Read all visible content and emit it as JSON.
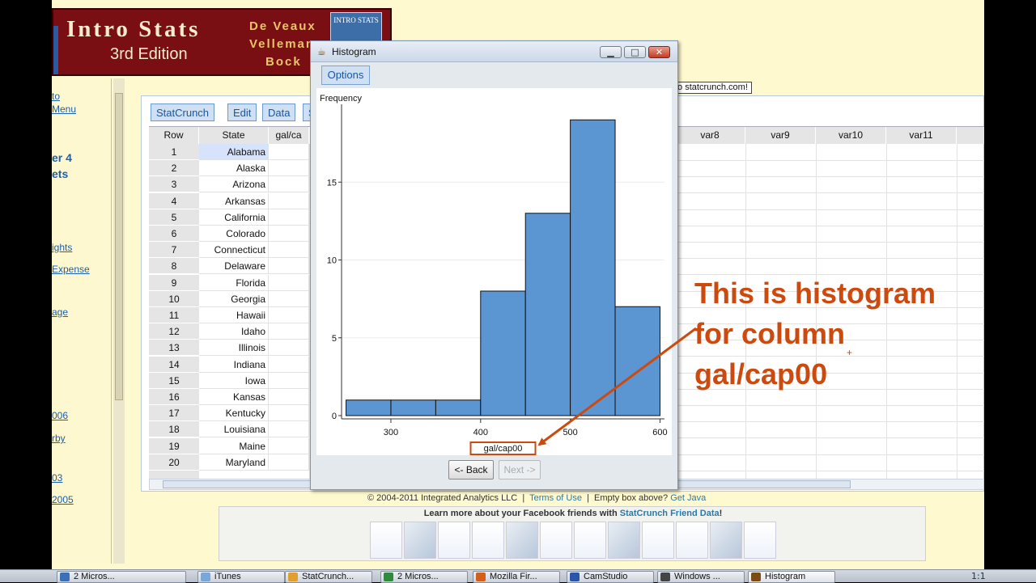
{
  "banner": {
    "title": "Intro Stats",
    "edition": "3rd Edition",
    "authors": [
      "De Veaux",
      "Velleman",
      "Bock"
    ],
    "cover_text": "INTRO STATS"
  },
  "left_nav": {
    "items": [
      {
        "label": "to",
        "kind": "link"
      },
      {
        "label": "Menu",
        "kind": "link"
      },
      {
        "label": "er 4",
        "kind": "head"
      },
      {
        "label": "ets",
        "kind": "head"
      },
      {
        "label": "ights",
        "kind": "link"
      },
      {
        "label": "Expense",
        "kind": "link"
      },
      {
        "label": "age",
        "kind": "link"
      },
      {
        "label": "006",
        "kind": "link"
      },
      {
        "label": "rby",
        "kind": "link"
      },
      {
        "label": "03",
        "kind": "link"
      },
      {
        "label": " 2005",
        "kind": "link"
      }
    ]
  },
  "statcrunch": {
    "menu": [
      "StatCrunch",
      "Edit",
      "Data",
      "S"
    ],
    "status_message": "to statcrunch.com!",
    "columns": {
      "row": "Row",
      "state": "State",
      "gal": "gal/ca",
      "right": [
        "var8",
        "var9",
        "var10",
        "var11"
      ]
    },
    "rows": [
      {
        "n": "1",
        "state": "Alabama"
      },
      {
        "n": "2",
        "state": "Alaska"
      },
      {
        "n": "3",
        "state": "Arizona"
      },
      {
        "n": "4",
        "state": "Arkansas"
      },
      {
        "n": "5",
        "state": "California"
      },
      {
        "n": "6",
        "state": "Colorado"
      },
      {
        "n": "7",
        "state": "Connecticut"
      },
      {
        "n": "8",
        "state": "Delaware"
      },
      {
        "n": "9",
        "state": "Florida"
      },
      {
        "n": "10",
        "state": "Georgia"
      },
      {
        "n": "11",
        "state": "Hawaii"
      },
      {
        "n": "12",
        "state": "Idaho"
      },
      {
        "n": "13",
        "state": "Illinois"
      },
      {
        "n": "14",
        "state": "Indiana"
      },
      {
        "n": "15",
        "state": "Iowa"
      },
      {
        "n": "16",
        "state": "Kansas"
      },
      {
        "n": "17",
        "state": "Kentucky"
      },
      {
        "n": "18",
        "state": "Louisiana"
      },
      {
        "n": "19",
        "state": "Maine"
      },
      {
        "n": "20",
        "state": "Maryland"
      }
    ],
    "footer": {
      "copyright": "© 2004-2011 Integrated Analytics LLC",
      "terms": "Terms of Use",
      "empty_box": "Empty box above?",
      "get_java": "Get Java"
    },
    "facebook_text": "Learn more about your Facebook friends with",
    "facebook_link": "StatCrunch Friend Data",
    "facebook_end": "!"
  },
  "histogram_window": {
    "title": "Histogram",
    "options_label": "Options",
    "back_label": "<- Back",
    "next_label": "Next ->",
    "minimize": "▁",
    "maximize": "□",
    "close": "✕"
  },
  "chart_data": {
    "type": "bar",
    "title": "",
    "xlabel": "gal/cap00",
    "ylabel": "Frequency",
    "bins": [
      [
        250,
        300
      ],
      [
        300,
        350
      ],
      [
        350,
        400
      ],
      [
        400,
        450
      ],
      [
        450,
        500
      ],
      [
        500,
        550
      ],
      [
        550,
        600
      ]
    ],
    "values": [
      1,
      1,
      1,
      8,
      13,
      19,
      7
    ],
    "xticks": [
      300,
      400,
      500,
      600
    ],
    "yticks": [
      0,
      5,
      10,
      15
    ],
    "xlim": [
      245,
      605
    ],
    "ylim": [
      0,
      20
    ],
    "bar_color": "#5b96d3",
    "highlight_color": "#cc4a0e",
    "grid": "horizontal"
  },
  "annotation": {
    "lines": [
      "This is histogram",
      "for column",
      "gal/cap00"
    ],
    "color": "#cc4a0e"
  },
  "taskbar": {
    "items": [
      {
        "label": "2 Micros...",
        "color": "#3b6fb6"
      },
      {
        "label": "iTunes",
        "color": "#7aa6d8"
      },
      {
        "label": "StatCrunch...",
        "color": "#e0a030"
      },
      {
        "label": "2 Micros...",
        "color": "#2f8a3e"
      },
      {
        "label": "Mozilla Fir...",
        "color": "#d2601a"
      },
      {
        "label": "CamStudio",
        "color": "#2b55a8"
      },
      {
        "label": "Windows ...",
        "color": "#444"
      },
      {
        "label": "Histogram",
        "color": "#7a4d14"
      }
    ],
    "clock": "1:1"
  }
}
